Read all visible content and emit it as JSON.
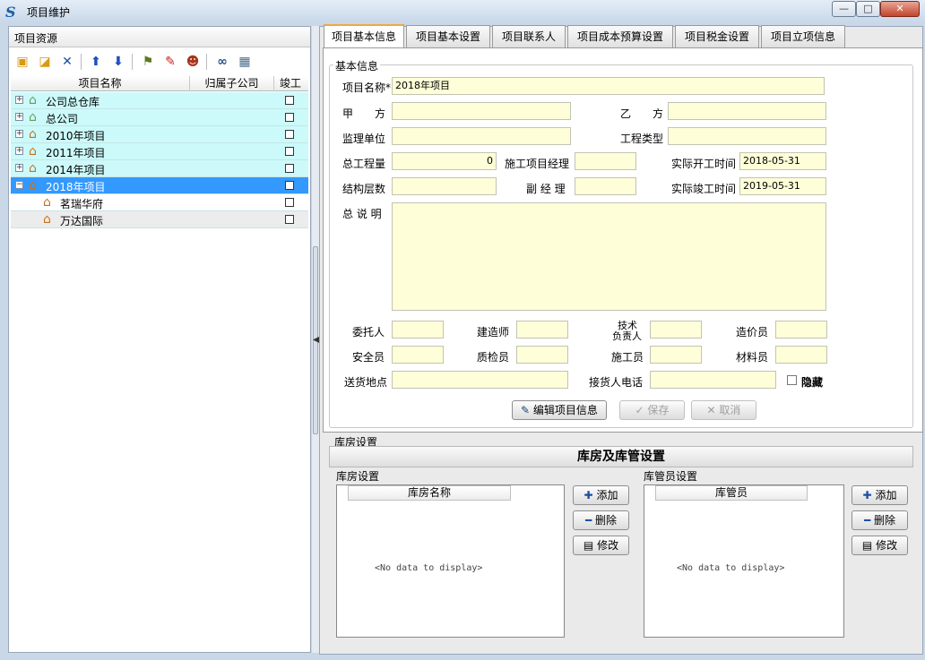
{
  "window": {
    "title": "项目维护",
    "app_icon": "S",
    "min": "—",
    "max": "□",
    "close": "✕"
  },
  "left": {
    "title": "项目资源",
    "toolbar": [
      "folder-open-icon",
      "folder-edit-icon",
      "delete-icon",
      "arrow-up-icon",
      "arrow-down-icon",
      "tag-icon",
      "tag-multi-icon",
      "users-icon",
      "binoculars-icon",
      "grid-icon"
    ],
    "columns": {
      "name": "项目名称",
      "company": "归属子公司",
      "done": "竣工"
    },
    "rows": [
      {
        "label": "公司总仓库",
        "level": 0,
        "expander": "+"
      },
      {
        "label": "总公司",
        "level": 0,
        "expander": "+"
      },
      {
        "label": "2010年项目",
        "level": 0,
        "expander": "+"
      },
      {
        "label": "2011年项目",
        "level": 0,
        "expander": "+"
      },
      {
        "label": "2014年项目",
        "level": 0,
        "expander": "+"
      },
      {
        "label": "2018年项目",
        "level": 0,
        "expander": "−",
        "selected": true
      },
      {
        "label": "茗瑞华府",
        "level": 1
      },
      {
        "label": "万达国际",
        "level": 1
      }
    ]
  },
  "tabs": [
    "项目基本信息",
    "项目基本设置",
    "项目联系人",
    "项目成本预算设置",
    "项目税金设置",
    "项目立项信息"
  ],
  "basic": {
    "group_title": "基本信息",
    "project_name_label": "项目名称*",
    "project_name": "2018年项目",
    "party_a_label": "甲　　方",
    "party_a": "",
    "party_b_label": "乙　　方",
    "party_b": "",
    "supervisor_label": "监理单位",
    "supervisor": "",
    "project_type_label": "工程类型",
    "project_type": "",
    "total_qty_label": "总工程量",
    "total_qty": "0",
    "pm_label": "施工项目经理",
    "pm": "",
    "start_label": "实际开工时间",
    "start": "2018-05-31",
    "floors_label": "结构层数",
    "floors": "",
    "deputy_label": "副 经 理",
    "deputy": "",
    "end_label": "实际竣工时间",
    "end": "2019-05-31",
    "desc_label": "总 说 明",
    "desc": "",
    "client_label": "委托人",
    "architect_label": "建造师",
    "tech_label_1": "技术",
    "tech_label_2": "负责人",
    "cost_label": "造价员",
    "safety_label": "安全员",
    "qc_label": "质检员",
    "builder_label": "施工员",
    "material_label": "材料员",
    "delivery_label": "送货地点",
    "receiver_phone_label": "接货人电话",
    "hide_label": "隐藏",
    "edit_btn": "编辑项目信息",
    "save_btn": "保存",
    "cancel_btn": "取消"
  },
  "warehouse": {
    "section_title": "库房设置",
    "banner": "库房及库管设置",
    "wh_title": "库房设置",
    "wh_col": "库房名称",
    "keeper_title": "库管员设置",
    "keeper_col": "库管员",
    "nodata": "<No data to display>",
    "add": "添加",
    "del": "删除",
    "edit": "修改"
  }
}
